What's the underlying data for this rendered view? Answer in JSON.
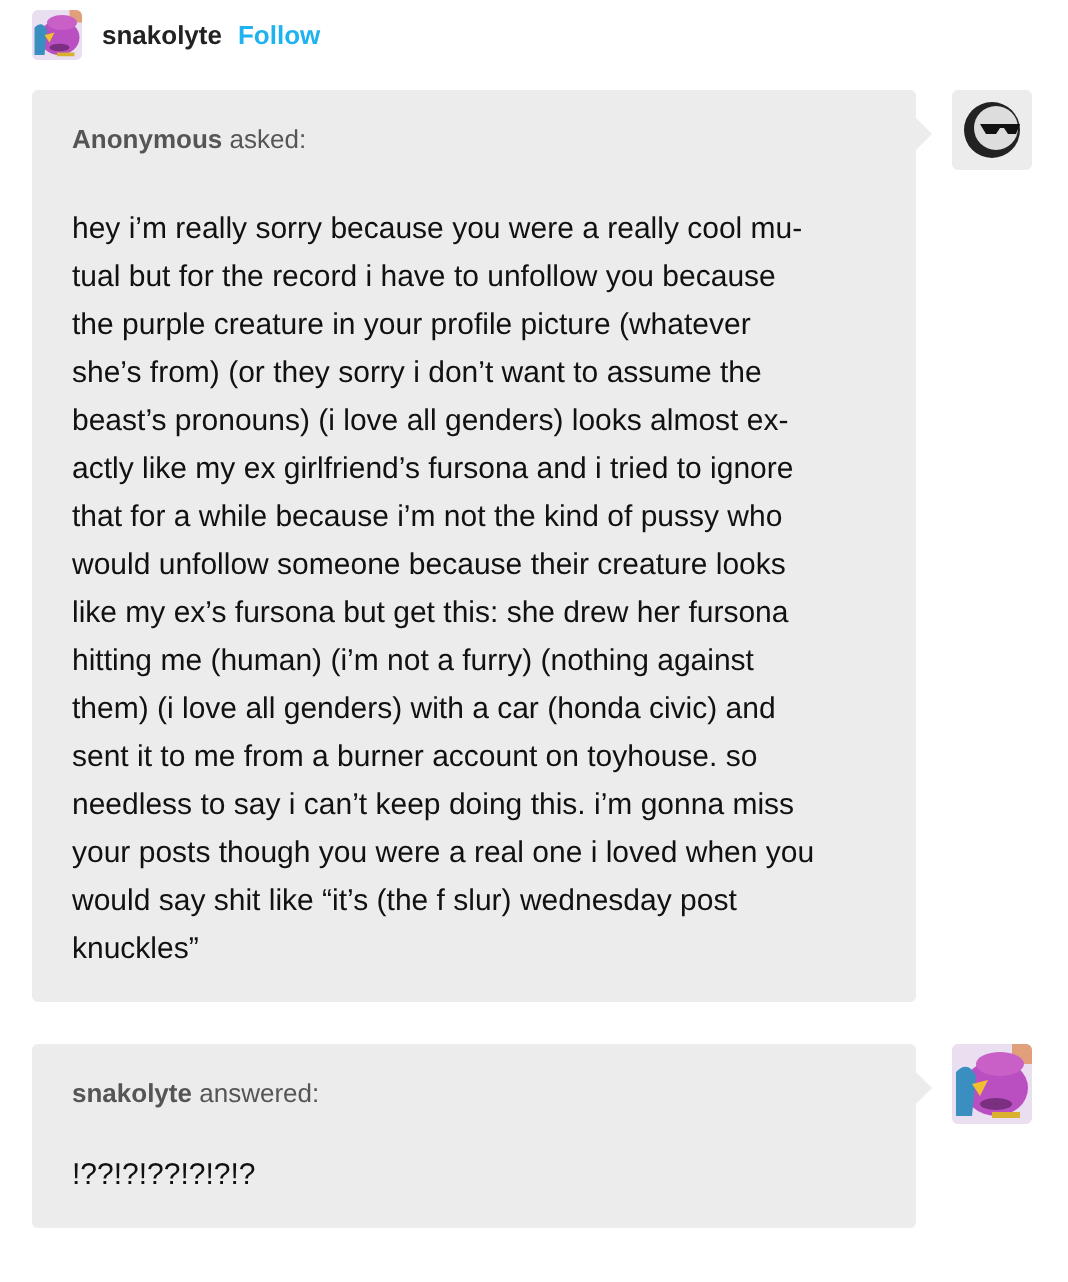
{
  "header": {
    "username": "snakolyte",
    "follow": "Follow"
  },
  "posts": [
    {
      "kind": "ask",
      "author": "Anonymous",
      "verb": "asked:",
      "avatar": {
        "kind": "icon"
      },
      "body": "hey i’m really sorry because you were a really cool mu-\ntual but for the record i have to unfollow you because\nthe purple creature in your profile picture (whatever\nshe’s from) (or they sorry i don’t want to assume the\nbeast’s pronouns) (i love all genders) looks almost ex-\nactly like my ex girlfriend’s fursona and i tried to ignore\nthat for a while because i’m not the kind of pussy who\nwould unfollow someone because their creature looks\nlike my ex’s fursona but get this: she drew her fursona\nhitting me (human) (i’m not a furry) (nothing against\nthem) (i love all genders) with a car (honda civic) and\nsent it to me from a burner account on toyhouse. so\nneedless to say i can’t keep doing this. i’m gonna miss\nyour posts though you were a real one i loved when you\nwould say shit like “it’s (the f slur) wednesday post\nknuckles”"
    },
    {
      "kind": "answer",
      "author": "snakolyte",
      "verb": "answered:",
      "body": "!??!?!??!?!?!?"
    }
  ]
}
